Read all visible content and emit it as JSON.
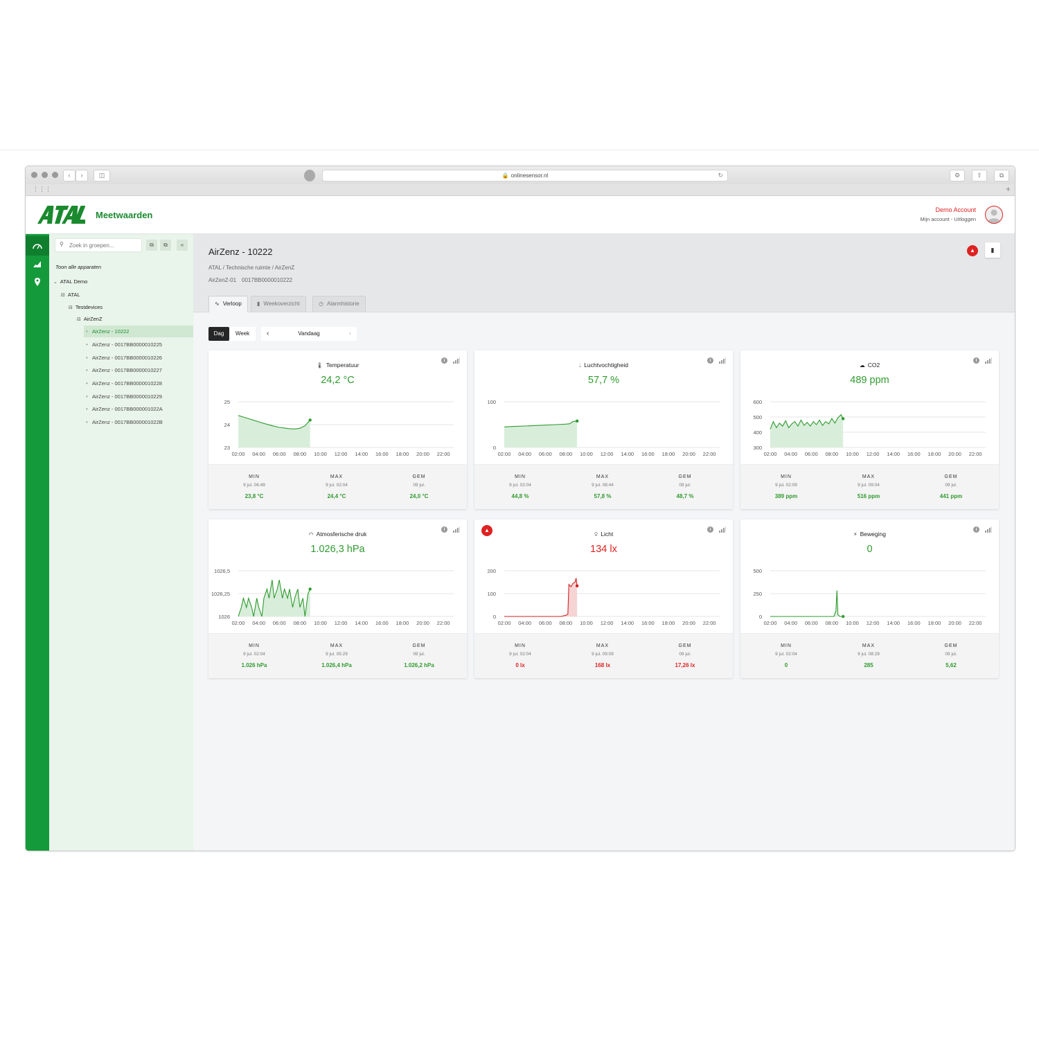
{
  "browser": {
    "url": "onlinesensor.nl"
  },
  "header": {
    "app_title": "Meetwaarden",
    "account_name": "Demo Account",
    "account_links": "Mijn account - Uitloggen"
  },
  "tree": {
    "search_placeholder": "Zoek in groepen...",
    "show_all": "Toon alle apparaten",
    "nodes": [
      "ATAL Demo",
      "ATAL",
      "Testdevices",
      "AirZenZ"
    ],
    "devices": [
      "AirZenz - 10222",
      "AirZenz - 0017BB0000010225",
      "AirZenz - 0017BB0000010226",
      "AirZenz - 0017BB0000010227",
      "AirZenz - 0017BB0000010228",
      "AirZenz - 0017BB0000010229",
      "AirZenz - 0017BB000001022A",
      "AirZenz - 0017BB000001022B"
    ],
    "selected_index": 0
  },
  "device": {
    "title": "AirZenz - 10222",
    "breadcrumb": "ATAL / Technische ruimte / AirZenZ",
    "model": "AirZenZ-01",
    "serial": "0017BB0000010222"
  },
  "tabs": [
    {
      "label": "Verloop",
      "active": true
    },
    {
      "label": "Weekoverzicht",
      "active": false
    },
    {
      "label": "Alarmhistorie",
      "active": false
    }
  ],
  "period": {
    "day": "Dag",
    "week": "Week",
    "date": "Vandaag"
  },
  "colors": {
    "brand": "#149a3a",
    "ok": "#2f9a2f",
    "alarm": "#d22222",
    "fill_ok": "#d8eedb",
    "fill_alarm": "#f6d4d4"
  },
  "cards": [
    {
      "title": "Temperatuur",
      "icon": "thermometer-icon",
      "value": "24,2 °C",
      "alarm": false,
      "stats": {
        "min_label": "MIN",
        "min_date": "9 jul. 06:49",
        "min_value": "23,8 °C",
        "max_label": "MAX",
        "max_date": "9 jul. 02:04",
        "max_value": "24,4 °C",
        "avg_label": "GEM",
        "avg_date": "09 jul.",
        "avg_value": "24,0 °C"
      }
    },
    {
      "title": "Luchtvochtigheid",
      "icon": "droplet-icon",
      "value": "57,7 %",
      "alarm": false,
      "stats": {
        "min_label": "MIN",
        "min_date": "9 jul. 02:04",
        "min_value": "44,8 %",
        "max_label": "MAX",
        "max_date": "9 jul. 08:44",
        "max_value": "57,8 %",
        "avg_label": "GEM",
        "avg_date": "09 jul.",
        "avg_value": "48,7 %"
      }
    },
    {
      "title": "CO2",
      "icon": "cloud-icon",
      "value": "489 ppm",
      "alarm": false,
      "stats": {
        "min_label": "MIN",
        "min_date": "9 jul. 02:09",
        "min_value": "389 ppm",
        "max_label": "MAX",
        "max_date": "9 jul. 09:04",
        "max_value": "516 ppm",
        "avg_label": "GEM",
        "avg_date": "09 jul.",
        "avg_value": "441 ppm"
      }
    },
    {
      "title": "Atmosferische druk",
      "icon": "gauge-icon",
      "value": "1.026,3 hPa",
      "alarm": false,
      "stats": {
        "min_label": "MIN",
        "min_date": "9 jul. 02:04",
        "min_value": "1.026 hPa",
        "max_label": "MAX",
        "max_date": "9 jul. 05:29",
        "max_value": "1.026,4 hPa",
        "avg_label": "GEM",
        "avg_date": "09 jul.",
        "avg_value": "1.026,2 hPa"
      }
    },
    {
      "title": "Licht",
      "icon": "lightbulb-icon",
      "value": "134 lx",
      "alarm": true,
      "stats": {
        "min_label": "MIN",
        "min_date": "9 jul. 02:04",
        "min_value": "0 lx",
        "max_label": "MAX",
        "max_date": "9 jul. 09:09",
        "max_value": "168 lx",
        "avg_label": "GEM",
        "avg_date": "09 jul.",
        "avg_value": "17,26 lx"
      }
    },
    {
      "title": "Beweging",
      "icon": "running-icon",
      "value": "0",
      "alarm": false,
      "stats": {
        "min_label": "MIN",
        "min_date": "9 jul. 02:04",
        "min_value": "0",
        "max_label": "MAX",
        "max_date": "9 jul. 08:29",
        "max_value": "285",
        "avg_label": "GEM",
        "avg_date": "09 jul.",
        "avg_value": "5,62"
      }
    }
  ],
  "chart_data": [
    {
      "type": "area",
      "title": "Temperatuur",
      "x_ticks": [
        "02:00",
        "04:00",
        "06:00",
        "08:00",
        "10:00",
        "12:00",
        "14:00",
        "16:00",
        "18:00",
        "20:00",
        "22:00"
      ],
      "y_ticks": [
        "23",
        "24",
        "25"
      ],
      "ylim": [
        23,
        25
      ],
      "xlim": [
        2,
        23
      ],
      "grid": true,
      "x": [
        2.0,
        2.5,
        3.0,
        3.5,
        4.0,
        4.5,
        5.0,
        5.5,
        6.0,
        6.5,
        7.0,
        7.5,
        8.0,
        8.5,
        9.0
      ],
      "y": [
        24.4,
        24.33,
        24.26,
        24.19,
        24.12,
        24.05,
        23.99,
        23.93,
        23.88,
        23.85,
        23.82,
        23.81,
        23.84,
        23.95,
        24.2
      ]
    },
    {
      "type": "area",
      "title": "Luchtvochtigheid",
      "x_ticks": [
        "02:00",
        "04:00",
        "06:00",
        "08:00",
        "10:00",
        "12:00",
        "14:00",
        "16:00",
        "18:00",
        "20:00",
        "22:00"
      ],
      "y_ticks": [
        "0",
        "100"
      ],
      "ylim": [
        0,
        100
      ],
      "xlim": [
        2,
        23
      ],
      "grid": true,
      "x": [
        2.0,
        3.0,
        4.0,
        5.0,
        6.0,
        7.0,
        8.0,
        8.4,
        8.7,
        9.1
      ],
      "y": [
        45,
        46,
        47,
        48,
        49,
        50,
        51,
        52,
        57,
        57.8
      ]
    },
    {
      "type": "area",
      "title": "CO2",
      "x_ticks": [
        "02:00",
        "04:00",
        "06:00",
        "08:00",
        "10:00",
        "12:00",
        "14:00",
        "16:00",
        "18:00",
        "20:00",
        "22:00"
      ],
      "y_ticks": [
        "300",
        "400",
        "500",
        "600"
      ],
      "ylim": [
        300,
        600
      ],
      "xlim": [
        2,
        23
      ],
      "grid": true,
      "x": [
        2.0,
        2.3,
        2.6,
        2.9,
        3.2,
        3.5,
        3.8,
        4.1,
        4.4,
        4.7,
        5.0,
        5.3,
        5.6,
        5.9,
        6.2,
        6.5,
        6.8,
        7.1,
        7.4,
        7.7,
        8.0,
        8.3,
        8.6,
        8.9,
        9.1
      ],
      "y": [
        420,
        470,
        430,
        460,
        440,
        475,
        430,
        455,
        470,
        440,
        480,
        445,
        465,
        440,
        470,
        450,
        480,
        445,
        470,
        455,
        490,
        460,
        495,
        515,
        489
      ]
    },
    {
      "type": "area",
      "title": "Atmosferische druk",
      "x_ticks": [
        "02:00",
        "04:00",
        "06:00",
        "08:00",
        "10:00",
        "12:00",
        "14:00",
        "16:00",
        "18:00",
        "20:00",
        "22:00"
      ],
      "y_ticks": [
        "1026",
        "1026,25",
        "1026,5"
      ],
      "ylim": [
        1026,
        1026.5
      ],
      "xlim": [
        2,
        23
      ],
      "grid": true,
      "x": [
        2.0,
        2.3,
        2.5,
        2.8,
        3.0,
        3.3,
        3.5,
        3.8,
        4.0,
        4.3,
        4.5,
        4.8,
        5.0,
        5.3,
        5.5,
        5.8,
        6.0,
        6.3,
        6.5,
        6.8,
        7.0,
        7.3,
        7.5,
        7.8,
        8.0,
        8.3,
        8.5,
        8.8,
        9.0
      ],
      "y": [
        1026.0,
        1026.1,
        1026.2,
        1026.1,
        1026.2,
        1026.1,
        1026.0,
        1026.2,
        1026.1,
        1026.0,
        1026.2,
        1026.3,
        1026.2,
        1026.4,
        1026.2,
        1026.3,
        1026.4,
        1026.2,
        1026.3,
        1026.2,
        1026.3,
        1026.1,
        1026.2,
        1026.3,
        1026.1,
        1026.2,
        1026.0,
        1026.25,
        1026.3
      ]
    },
    {
      "type": "area",
      "title": "Licht",
      "x_ticks": [
        "02:00",
        "04:00",
        "06:00",
        "08:00",
        "10:00",
        "12:00",
        "14:00",
        "16:00",
        "18:00",
        "20:00",
        "22:00"
      ],
      "y_ticks": [
        "0",
        "100",
        "200"
      ],
      "ylim": [
        0,
        200
      ],
      "xlim": [
        2,
        23
      ],
      "grid": true,
      "x": [
        2.0,
        4.0,
        6.0,
        7.5,
        8.0,
        8.2,
        8.3,
        8.5,
        8.7,
        8.9,
        9.0,
        9.1
      ],
      "y": [
        0,
        0,
        0,
        0,
        5,
        10,
        140,
        130,
        145,
        150,
        168,
        134
      ]
    },
    {
      "type": "area",
      "title": "Beweging",
      "x_ticks": [
        "02:00",
        "04:00",
        "06:00",
        "08:00",
        "10:00",
        "12:00",
        "14:00",
        "16:00",
        "18:00",
        "20:00",
        "22:00"
      ],
      "y_ticks": [
        "0",
        "250",
        "500"
      ],
      "ylim": [
        0,
        500
      ],
      "xlim": [
        2,
        23
      ],
      "grid": true,
      "x": [
        2.0,
        4.0,
        6.0,
        8.0,
        8.2,
        8.4,
        8.5,
        8.6,
        8.8,
        9.0,
        9.1
      ],
      "y": [
        0,
        0,
        0,
        0,
        0,
        60,
        285,
        20,
        0,
        0,
        0
      ]
    }
  ]
}
